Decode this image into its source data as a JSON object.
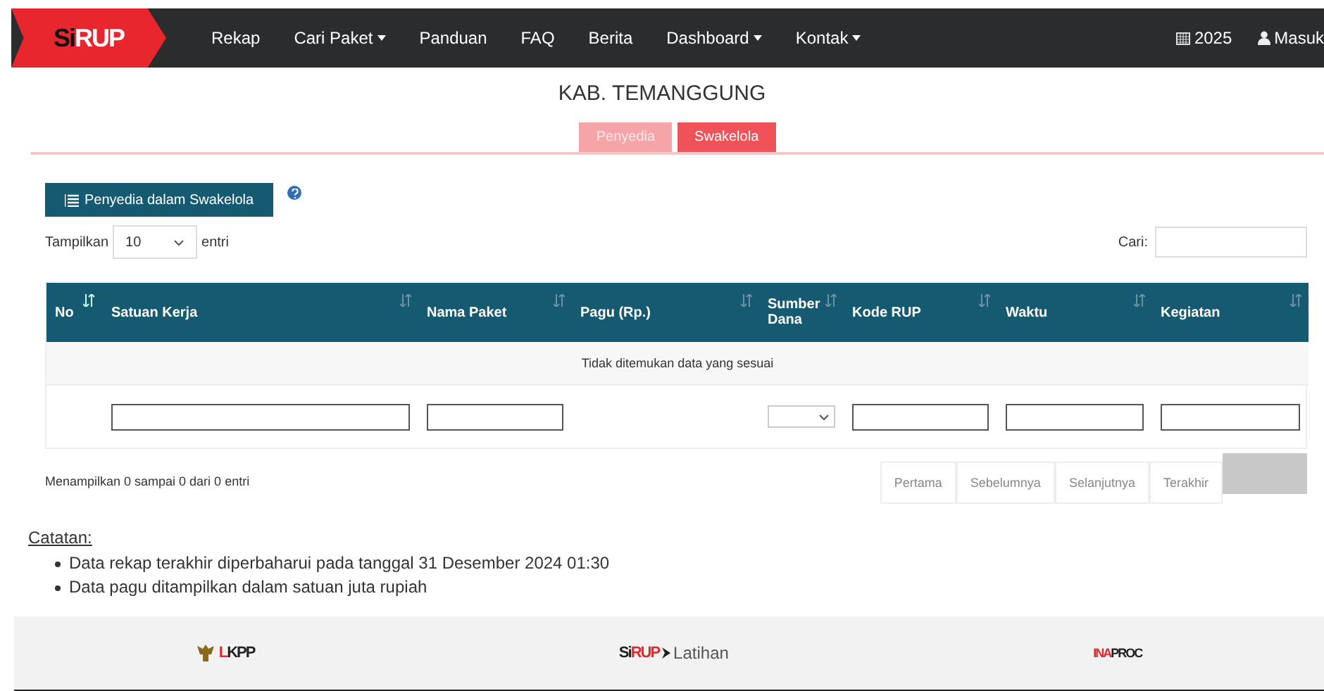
{
  "navbar": {
    "brand": {
      "prefix": "Si",
      "main": "RUP"
    },
    "menu": [
      {
        "label": "Rekap",
        "dropdown": false
      },
      {
        "label": "Cari Paket",
        "dropdown": true
      },
      {
        "label": "Panduan",
        "dropdown": false
      },
      {
        "label": "FAQ",
        "dropdown": false
      },
      {
        "label": "Berita",
        "dropdown": false
      },
      {
        "label": "Dashboard",
        "dropdown": true
      },
      {
        "label": "Kontak",
        "dropdown": true
      }
    ],
    "year": "2025",
    "login": "Masuk"
  },
  "page_title": "KAB. TEMANGGUNG",
  "tabs": [
    {
      "label": "Penyedia",
      "selected": false
    },
    {
      "label": "Swakelola",
      "selected": true
    }
  ],
  "action_button": "Penyedia dalam Swakelola",
  "length": {
    "label": "Tampilkan",
    "value": "10",
    "suffix": "entri"
  },
  "search": {
    "label": "Cari:"
  },
  "table": {
    "columns": [
      {
        "label": "No",
        "sorted": true
      },
      {
        "label": "Satuan Kerja",
        "sorted": false
      },
      {
        "label": "Nama Paket",
        "sorted": false
      },
      {
        "label": "Pagu (Rp.)",
        "sorted": false
      },
      {
        "label": "Sumber Dana",
        "sorted": false
      },
      {
        "label": "Kode RUP",
        "sorted": false
      },
      {
        "label": "Waktu",
        "sorted": false
      },
      {
        "label": "Kegiatan",
        "sorted": false
      }
    ],
    "filters": [
      {
        "kind": "none"
      },
      {
        "kind": "text"
      },
      {
        "kind": "text"
      },
      {
        "kind": "none"
      },
      {
        "kind": "select"
      },
      {
        "kind": "text"
      },
      {
        "kind": "text"
      },
      {
        "kind": "text"
      }
    ],
    "empty_message": "Tidak ditemukan data yang sesuai"
  },
  "info": "Menampilkan 0 sampai 0 dari 0 entri",
  "pagination": [
    {
      "label": "Pertama",
      "disabled": true
    },
    {
      "label": "Sebelumnya",
      "disabled": true
    },
    {
      "label": "Selanjutnya",
      "disabled": true
    },
    {
      "label": "Terakhir",
      "disabled": true
    }
  ],
  "notes": {
    "title": "Catatan:",
    "items": [
      "Data rekap terakhir diperbaharui pada tanggal 31 Desember 2024 01:30",
      "Data pagu ditampilkan dalam satuan juta rupiah"
    ]
  },
  "footer": {
    "lkpp": "LKPP",
    "sirup": {
      "prefix": "Si",
      "main": "RUP",
      "suffix": "Latihan"
    },
    "inaproc": {
      "red": "INA",
      "dark": "PROC"
    }
  }
}
